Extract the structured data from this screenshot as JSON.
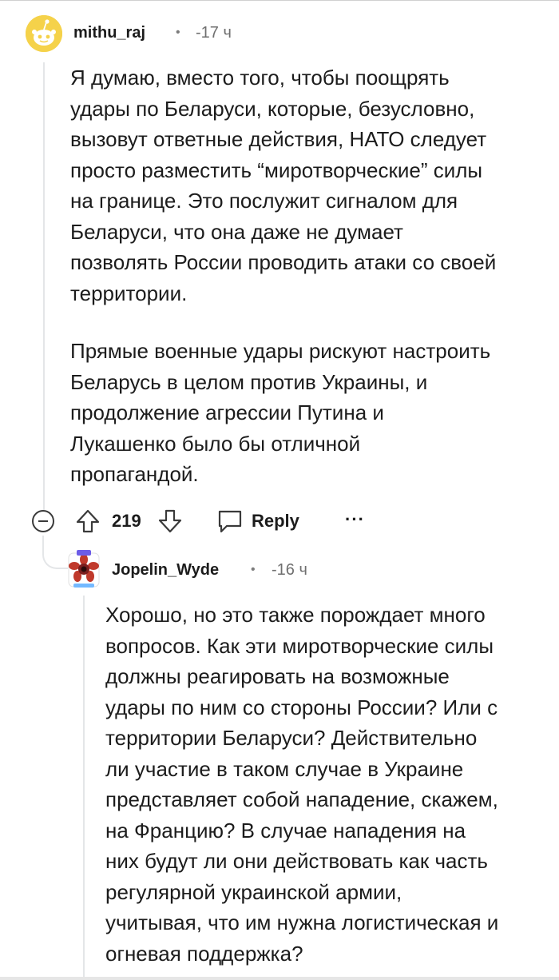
{
  "comment": {
    "username": "mithu_raj",
    "separator": "•",
    "time": "-17 ч",
    "body": "Я думаю, вместо того, чтобы поощрять\nудары по Беларуси, которые, безусловно,\nвызовут ответные действия, НАТО следует\nпросто разместить “миротворческие” силы\nна границе. Это послужит сигналом для\nБеларуси, что она даже не думает\nпозволять России проводить атаки со своей\nтерритории.",
    "body2": "Прямые военные удары рискуют настроить\nБеларусь в целом против Украины, и\nпродолжение агрессии Путина и\nЛукашенко было бы отличной\nпропагандой.",
    "vote_count": "219",
    "reply_label": "Reply",
    "more_label": "···"
  },
  "reply": {
    "username": "Jopelin_Wyde",
    "separator": "•",
    "time": "-16 ч",
    "body": "Хорошо, но это также порождает много\nвопросов. Как эти миротворческие силы\nдолжны реагировать на возможные\nудары по ним со стороны России? Или с\nтерритории Беларуси? Действительно\nли участие в таком случае в Украине\nпредставляет собой нападение, скажем,\nна Францию? В случае нападения на\nних будут ли они действовать как часть\nрегулярной украинской армии,\nучитывая, что им нужна логистическая и\nогневая поддержка?"
  },
  "icons": {
    "avatar_1": "snoo-avatar-icon",
    "avatar_2": "monster-flower-avatar-icon",
    "collapse": "collapse-minus-icon",
    "upvote": "upvote-arrow-icon",
    "downvote": "downvote-arrow-icon",
    "reply": "speech-bubble-icon"
  },
  "colors": {
    "avatar_yellow": "#f5d24a",
    "thread_line": "#e4e6e8",
    "text": "#1c1c1c",
    "meta": "#6f6f6f"
  }
}
